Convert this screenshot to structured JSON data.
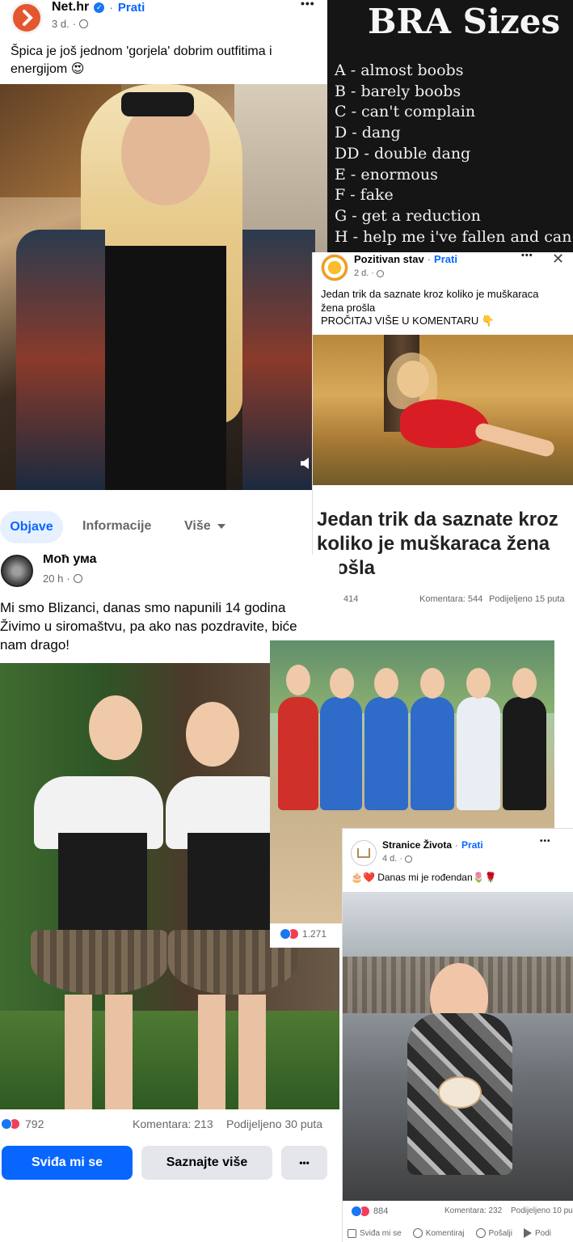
{
  "post_nethr": {
    "page_name": "Net.hr",
    "follow": "Prati",
    "time": "3 d.",
    "text": "Špica je još jednom 'gorjela' dobrim outfitima i energijom 😍",
    "more": "•••"
  },
  "bra_meme": {
    "title": "BRA Sizes",
    "lines": [
      "A  - almost boobs",
      "B  - barely boobs",
      "C  - can't complain",
      "D  - dang",
      "DD - double dang",
      "E  - enormous",
      "F  - fake",
      "G  - get a reduction",
      "H  - help me i've fallen and can't"
    ]
  },
  "profile_tabs": {
    "tabs": [
      "Objave",
      "Informacije",
      "Više"
    ]
  },
  "post_pozitivan": {
    "page_name": "Pozitivan stav",
    "follow": "Prati",
    "time": "2 d.",
    "text_line1": "Jedan trik da saznate kroz koliko je muškaraca žena prošla",
    "text_line2": "PROČITAJ VIŠE U KOMENTARU 👇",
    "headline": "Jedan trik da saznate kroz koliko je muškaraca žena prošla",
    "reactions": "414",
    "comments": "Komentara: 544",
    "shares": "Podijeljeno 15 puta",
    "more": "•••",
    "close": "✕"
  },
  "post_mocuma": {
    "page_name": "Моћ ума",
    "time": "20 h",
    "text": "Mi smo Blizanci, danas smo napunili 14 godina Živimo u siromaštvu, pa ako nas pozdravite, biće nam drago!",
    "reactions": "792",
    "comments": "Komentara: 213",
    "shares": "Podijeljeno 30 puta",
    "like_button": "Sviđa mi se",
    "learn_button": "Saznajte više",
    "more_button": "•••"
  },
  "post_women": {
    "reactions": "1.271"
  },
  "post_stranice": {
    "page_name": "Stranice Života",
    "follow": "Prati",
    "time": "4 d.",
    "text": "🎂❤️ Danas mi je rođendan🌷🌹",
    "reactions": "884",
    "comments": "Komentara: 232",
    "shares": "Podijeljeno 10 pu",
    "actions": [
      "Sviđa mi se",
      "Komentiraj",
      "Pošalji",
      "Podi"
    ],
    "more": "•••"
  }
}
